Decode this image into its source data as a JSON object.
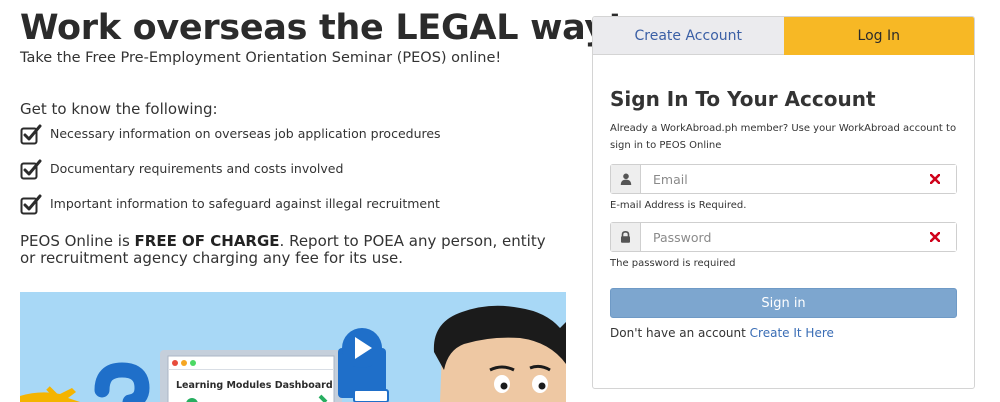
{
  "hero": {
    "headline": "Work overseas the LEGAL way!",
    "subhead": "Take the Free Pre-Employment Orientation Seminar (PEOS) online!",
    "know_title": "Get to know the following:",
    "bullets": [
      "Necessary information on overseas job application procedures",
      "Documentary requirements and costs involved",
      "Important information to safeguard against illegal recruitment"
    ],
    "notice_pre": "PEOS Online is ",
    "notice_bold": "FREE OF CHARGE",
    "notice_post": ". Report to POEA any person, entity or recruitment agency charging any fee for its use."
  },
  "illustration": {
    "window_title": "Learning Modules Dashboard",
    "icons": [
      "question-mark-icon",
      "play-icon",
      "airplane-icon",
      "checkmark-icon"
    ]
  },
  "auth": {
    "tabs": [
      {
        "label": "Create Account",
        "active": false
      },
      {
        "label": "Log In",
        "active": true
      }
    ],
    "title": "Sign In To Your Account",
    "description": "Already a WorkAbroad.ph member? Use your WorkAbroad account to sign in to PEOS Online",
    "email": {
      "placeholder": "Email",
      "value": "",
      "error": "E-mail Address is Required.",
      "icon": "user-icon"
    },
    "password": {
      "placeholder": "Password",
      "value": "",
      "error": "The password is required",
      "icon": "lock-icon"
    },
    "submit_label": "Sign in",
    "footer_text": "Don't have an account ",
    "footer_link": "Create It Here"
  },
  "colors": {
    "tab_active": "#f7b825",
    "tab_inactive": "#ebebee",
    "button": "#7da6cf",
    "link": "#3a5fa5",
    "error_x": "#d0021b",
    "illustration_bg": "#a8d8f6"
  }
}
